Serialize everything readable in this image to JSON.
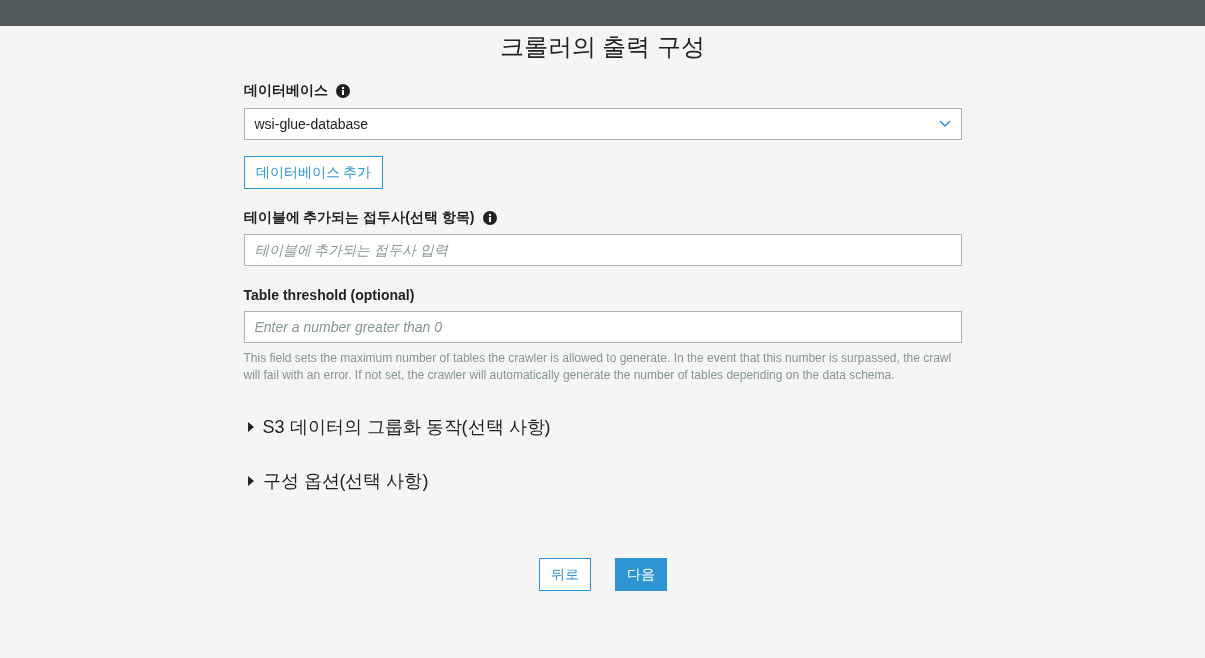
{
  "title": "크롤러의 출력 구성",
  "database": {
    "label": "데이터베이스",
    "value": "wsi-glue-database"
  },
  "add_database_button": "데이터베이스 추가",
  "prefix": {
    "label": "테이블에 추가되는 접두사(선택 항목)",
    "placeholder": "테이블에 추가되는 접두사 입력"
  },
  "threshold": {
    "label": "Table threshold (optional)",
    "placeholder": "Enter a number greater than 0",
    "help": "This field sets the maximum number of tables the crawler is allowed to generate. In the event that this number is surpassed, the crawl will fail with an error. If not set, the crawler will automatically generate the number of tables depending on the data schema."
  },
  "sections": [
    {
      "label": "S3 데이터의 그룹화 동작(선택 사항)",
      "expanded": false
    },
    {
      "label": "구성 옵션(선택 사항)",
      "expanded": false
    }
  ],
  "buttons": {
    "back": "뒤로",
    "next": "다음"
  }
}
